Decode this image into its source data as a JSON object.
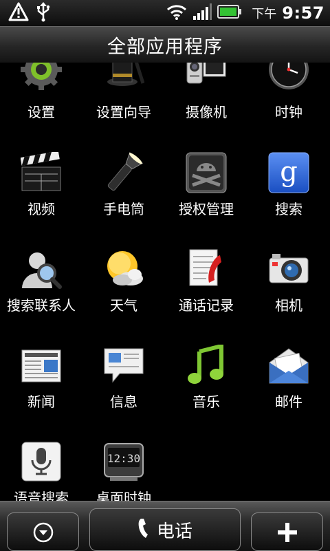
{
  "status_bar": {
    "ampm": "下午",
    "time": "9:57",
    "icons": [
      "warning-icon",
      "usb-icon",
      "wifi-icon",
      "signal-icon",
      "battery-icon"
    ]
  },
  "title": "全部应用程序",
  "apps": [
    {
      "label": "设置",
      "icon": "settings-gear-icon"
    },
    {
      "label": "设置向导",
      "icon": "magic-hat-icon"
    },
    {
      "label": "摄像机",
      "icon": "camcorder-icon"
    },
    {
      "label": "时钟",
      "icon": "clock-icon"
    },
    {
      "label": "视频",
      "icon": "clapperboard-icon"
    },
    {
      "label": "手电筒",
      "icon": "flashlight-icon"
    },
    {
      "label": "授权管理",
      "icon": "android-superuser-icon"
    },
    {
      "label": "搜索",
      "icon": "google-search-icon"
    },
    {
      "label": "搜索联系人",
      "icon": "people-search-icon"
    },
    {
      "label": "天气",
      "icon": "weather-sun-cloud-icon"
    },
    {
      "label": "通话记录",
      "icon": "call-log-icon"
    },
    {
      "label": "相机",
      "icon": "camera-icon"
    },
    {
      "label": "新闻",
      "icon": "newspaper-icon"
    },
    {
      "label": "信息",
      "icon": "messages-icon"
    },
    {
      "label": "音乐",
      "icon": "music-note-icon"
    },
    {
      "label": "邮件",
      "icon": "mail-envelope-icon"
    },
    {
      "label": "语音搜索",
      "icon": "microphone-icon"
    },
    {
      "label": "桌面时钟",
      "icon": "desk-clock-icon"
    }
  ],
  "dock": {
    "phone_label": "电话",
    "icons": [
      "collapse-down-icon",
      "phone-icon",
      "add-icon"
    ]
  },
  "desk_clock_display": "12:30"
}
